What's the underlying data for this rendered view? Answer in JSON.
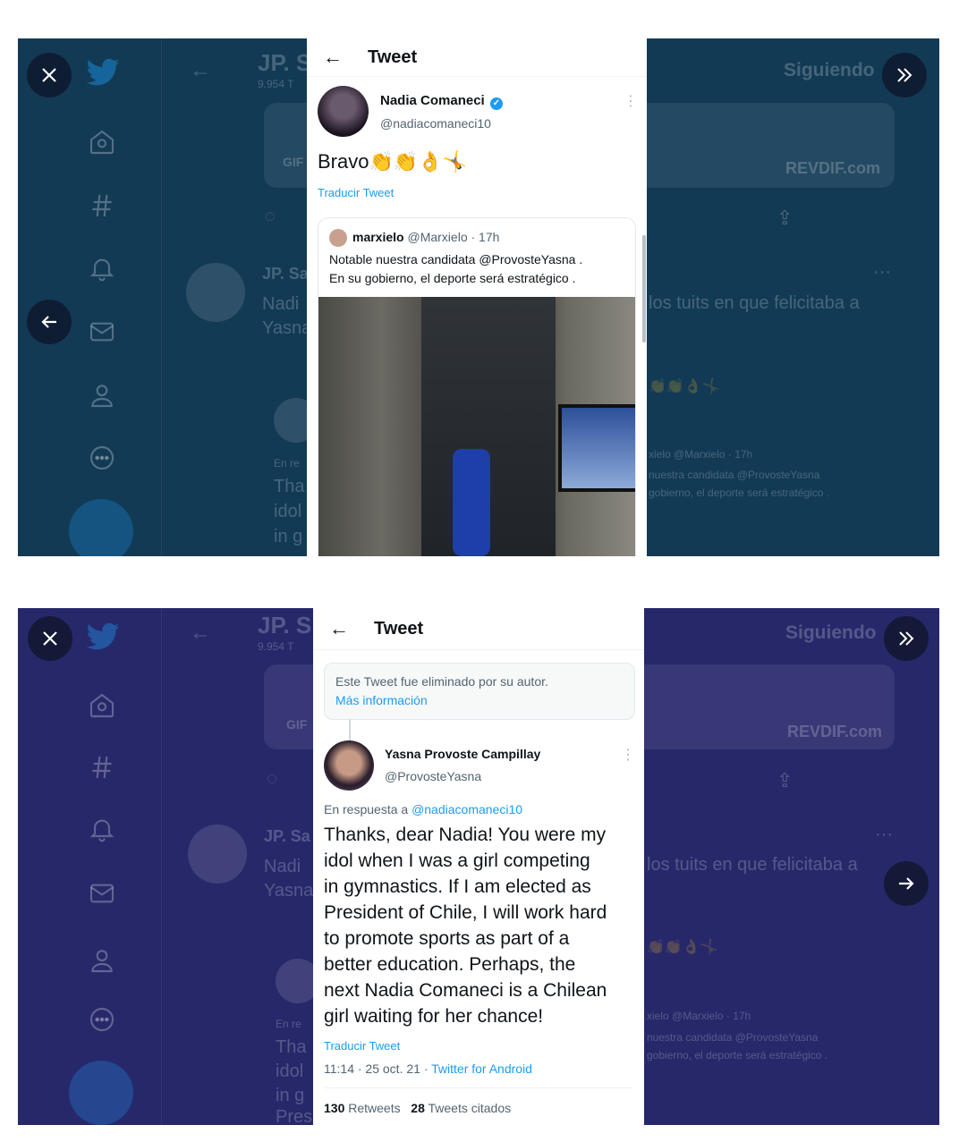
{
  "background": {
    "profile_name": "JP. S",
    "profile_subtext": "9.954 T",
    "follow_button": "Siguiendo",
    "gif_badge": "GIF",
    "watermark": "REVDIF.com",
    "bg_tweet_author": "JP. Sa",
    "bg_tweet_line1": "Nadi",
    "bg_tweet_line2": "Yasna",
    "bg_tweet_fragment": "los tuits en que felicitaba a",
    "bg_quote_line1": "idol",
    "bg_quote_line2": "in g",
    "bg_quote_line0": "Tha",
    "bg_reply_label": "En re",
    "bg_marxielo": "xielo @Marxielo · 17h",
    "bg_marxielo_l1": "nuestra candidata @ProvosteYasna",
    "bg_marxielo_l2": "gobierno, el deporte será estratégico .",
    "bg_shot2_extra": "Pres"
  },
  "screen1": {
    "header_title": "Tweet",
    "author_name": "Nadia Comaneci",
    "author_handle": "@nadiacomaneci10",
    "tweet_text": "Bravo",
    "tweet_emojis": "👏👏👌🤸",
    "translate": "Traducir Tweet",
    "quote": {
      "author_name": "marxielo",
      "meta": "@Marxielo · 17h",
      "line1": "Notable nuestra candidata @ProvosteYasna .",
      "line2": "En su gobierno, el deporte será estratégico ."
    }
  },
  "screen2": {
    "header_title": "Tweet",
    "deleted_notice": "Este Tweet fue eliminado por su autor.",
    "more_info": "Más información",
    "author_name": "Yasna Provoste Campillay",
    "author_handle": "@ProvosteYasna",
    "reply_prefix": "En respuesta a",
    "reply_handle": "@nadiacomaneci10",
    "body_lines": [
      "Thanks, dear Nadia! You were my",
      "idol when I was a girl competing",
      "in gymnastics. If I am elected as",
      "President of Chile, I will work hard",
      "to promote sports as part of a",
      "better education. Perhaps, the",
      "next Nadia Comaneci is a Chilean",
      "girl waiting for her chance!"
    ],
    "translate": "Traducir Tweet",
    "timestamp": "11:14 · 25 oct. 21 ·",
    "source": "Twitter for Android",
    "retweets_count": "130",
    "retweets_label": "Retweets",
    "quotes_count": "28",
    "quotes_label": "Tweets citados"
  },
  "icons": [
    "close-icon",
    "next-icon",
    "prev-arrow-icon",
    "next-arrow-icon",
    "back-arrow-icon",
    "verified-icon",
    "more-icon",
    "twitter-logo-icon",
    "home-icon",
    "hashtag-icon",
    "bell-icon",
    "mail-icon",
    "profile-icon",
    "more-circle-icon",
    "compose-icon"
  ],
  "colors": {
    "shot1_overlay": "#123a55",
    "shot2_overlay": "#27286a",
    "link": "#1d9bf0",
    "text": "#0f1419",
    "muted": "#536471"
  }
}
